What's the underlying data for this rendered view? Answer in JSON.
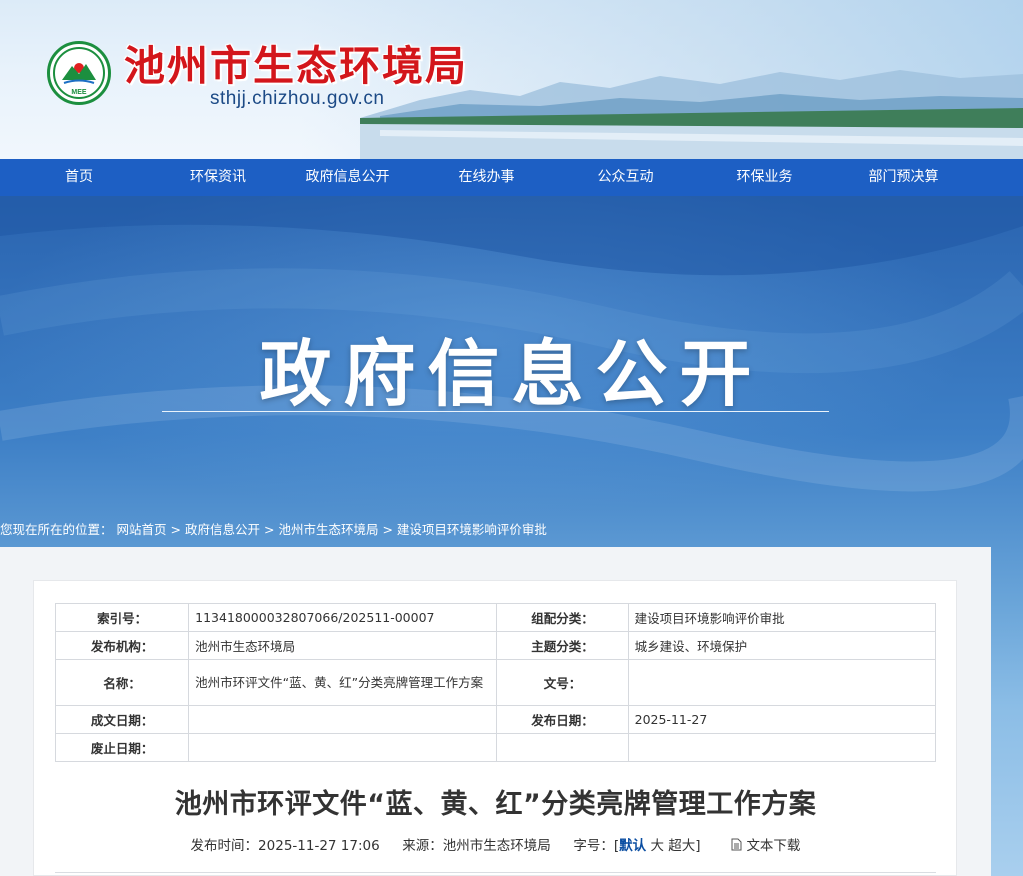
{
  "site": {
    "title": "池州市生态环境局",
    "domain": "sthjj.chizhou.gov.cn",
    "logo_text": "MEE"
  },
  "nav": {
    "items": [
      "首页",
      "环保资讯",
      "政府信息公开",
      "在线办事",
      "公众互动",
      "环保业务",
      "部门预决算"
    ]
  },
  "banner": {
    "title": "政府信息公开"
  },
  "breadcrumb": {
    "prefix": "您现在所在的位置：",
    "items": [
      "网站首页",
      "政府信息公开",
      "池州市生态环境局",
      "建设项目环境影响评价审批"
    ],
    "separator": ">"
  },
  "meta_table": {
    "index_label": "索引号：",
    "index_value": "113418000032807066/202511-00007",
    "category_label": "组配分类：",
    "category_value": "建设项目环境影响评价审批",
    "publisher_label": "发布机构：",
    "publisher_value": "池州市生态环境局",
    "topic_label": "主题分类：",
    "topic_value": "城乡建设、环境保护",
    "name_label": "名称：",
    "name_value": "池州市环评文件“蓝、黄、红”分类亮牌管理工作方案",
    "docno_label": "文号：",
    "docno_value": "",
    "created_label": "成文日期：",
    "created_value": "",
    "published_label": "发布日期：",
    "published_value": "2025-11-27",
    "expire_label": "废止日期：",
    "expire_value": ""
  },
  "article": {
    "title": "池州市环评文件“蓝、黄、红”分类亮牌管理工作方案",
    "publish_time_label": "发布时间：",
    "publish_time": "2025-11-27 17:06",
    "source_label": "来源：",
    "source": "池州市生态环境局",
    "font_size_label": "字号：[",
    "font_size_options": [
      "默认",
      "大",
      "超大"
    ],
    "font_size_close": "]",
    "download_label": "文本下载",
    "download_icon": "document-icon"
  },
  "colors": {
    "nav_bg": "#1d5fc4",
    "title_red": "#d3161b",
    "banner_blue": "#2f6db5"
  }
}
